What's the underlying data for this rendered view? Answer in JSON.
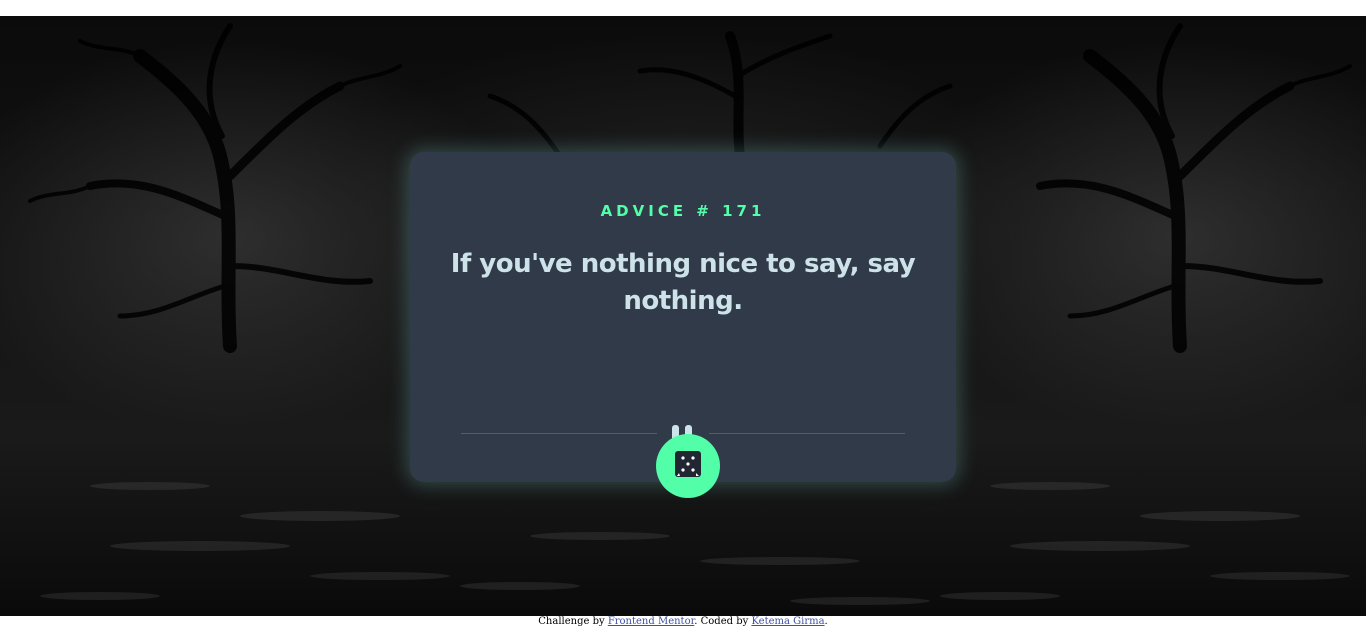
{
  "advice": {
    "heading": "ADVICE # 171",
    "text": "If you've nothing nice to say, say nothing."
  },
  "icons": {
    "divider": "pause-icon",
    "generate_button": "dice-icon"
  },
  "footer": {
    "prefix": "Challenge by ",
    "challenge_link": "Frontend Mentor",
    "middle": ". Coded by ",
    "author_link": "Ketema Girma",
    "suffix": "."
  },
  "colors": {
    "accent": "#52ffa8",
    "card": "#313a49",
    "text": "#cee3e9",
    "divider": "#4f5d74",
    "link": "#3e52a3"
  }
}
